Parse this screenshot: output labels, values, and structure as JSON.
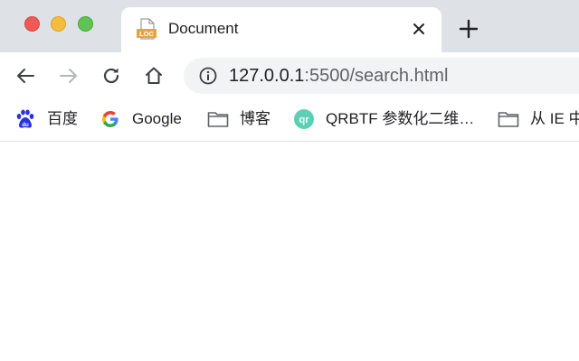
{
  "tab": {
    "title": "Document",
    "favicon_label": "LOC",
    "favicon_color": "#e8a33c"
  },
  "toolbar": {
    "url_host": "127.0.0.1",
    "url_rest": ":5500/search.html"
  },
  "bookmarks": [
    {
      "label": "百度",
      "icon": "baidu-icon"
    },
    {
      "label": "Google",
      "icon": "google-icon"
    },
    {
      "label": "博客",
      "icon": "folder-icon"
    },
    {
      "label": "QRBTF 参数化二维…",
      "icon": "qrbtf-icon",
      "icon_text": "qr"
    },
    {
      "label": "从 IE 中",
      "icon": "folder-icon"
    }
  ],
  "colors": {
    "tabstrip": "#dee1e6",
    "omnibox": "#f1f3f4",
    "close": "#ee5b56",
    "minimize": "#f5bd3c",
    "maximize": "#5fc453",
    "baidu_blue": "#2932e1",
    "qrbtf_teal": "#5ccfb4"
  }
}
